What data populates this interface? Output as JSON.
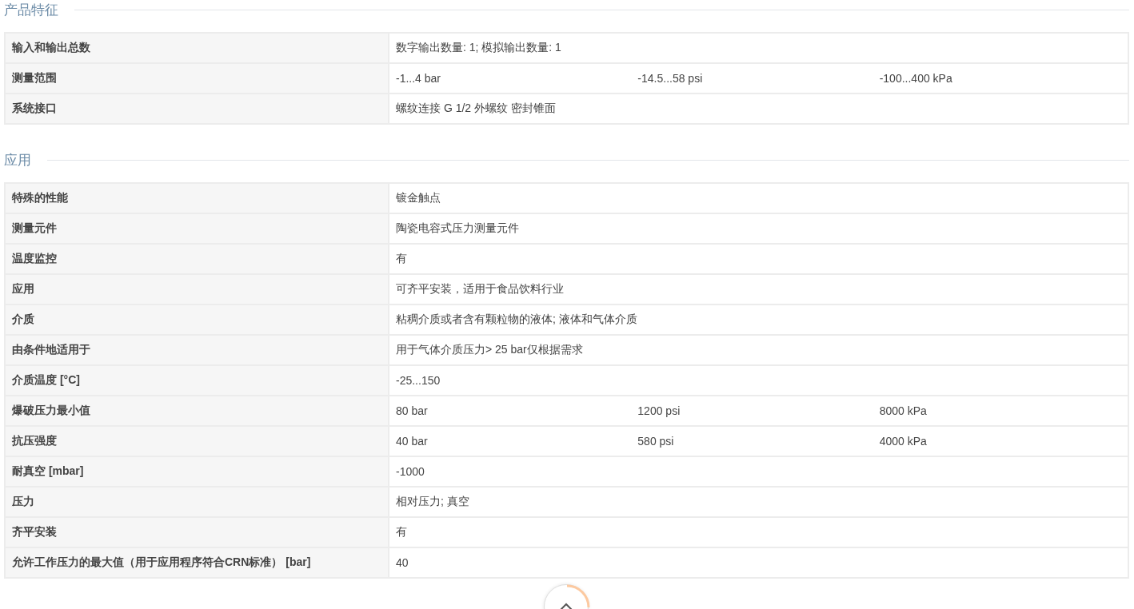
{
  "sections": [
    {
      "title": "产品特征",
      "rows": [
        {
          "label": "输入和输出总数",
          "values": [
            "数字输出数量: 1; 模拟输出数量: 1"
          ]
        },
        {
          "label": "测量范围",
          "values": [
            "-1...4 bar",
            "-14.5...58 psi",
            "-100...400 kPa"
          ]
        },
        {
          "label": "系统接口",
          "values": [
            "螺纹连接 G 1/2 外螺纹 密封锥面"
          ]
        }
      ]
    },
    {
      "title": "应用",
      "rows": [
        {
          "label": "特殊的性能",
          "values": [
            "镀金触点"
          ]
        },
        {
          "label": "测量元件",
          "values": [
            "陶瓷电容式压力测量元件"
          ]
        },
        {
          "label": "温度监控",
          "values": [
            "有"
          ]
        },
        {
          "label": "应用",
          "values": [
            "可齐平安装，适用于食品饮料行业"
          ]
        },
        {
          "label": "介质",
          "values": [
            "粘稠介质或者含有颗粒物的液体; 液体和气体介质"
          ]
        },
        {
          "label": "由条件地适用于",
          "values": [
            "用于气体介质压力> 25 bar仅根据需求"
          ]
        },
        {
          "label": "介质温度 [°C]",
          "values": [
            "-25...150"
          ]
        },
        {
          "label": "爆破压力最小值",
          "values": [
            "80 bar",
            "1200 psi",
            "8000 kPa"
          ]
        },
        {
          "label": "抗压强度",
          "values": [
            "40 bar",
            "580 psi",
            "4000 kPa"
          ]
        },
        {
          "label": "耐真空 [mbar]",
          "values": [
            "-1000"
          ]
        },
        {
          "label": "压力",
          "values": [
            "相对压力; 真空"
          ]
        },
        {
          "label": "齐平安装",
          "values": [
            "有"
          ]
        },
        {
          "label": "允许工作压力的最大值（用于应用程序符合CRN标准） [bar]",
          "values": [
            "40"
          ]
        }
      ]
    }
  ]
}
